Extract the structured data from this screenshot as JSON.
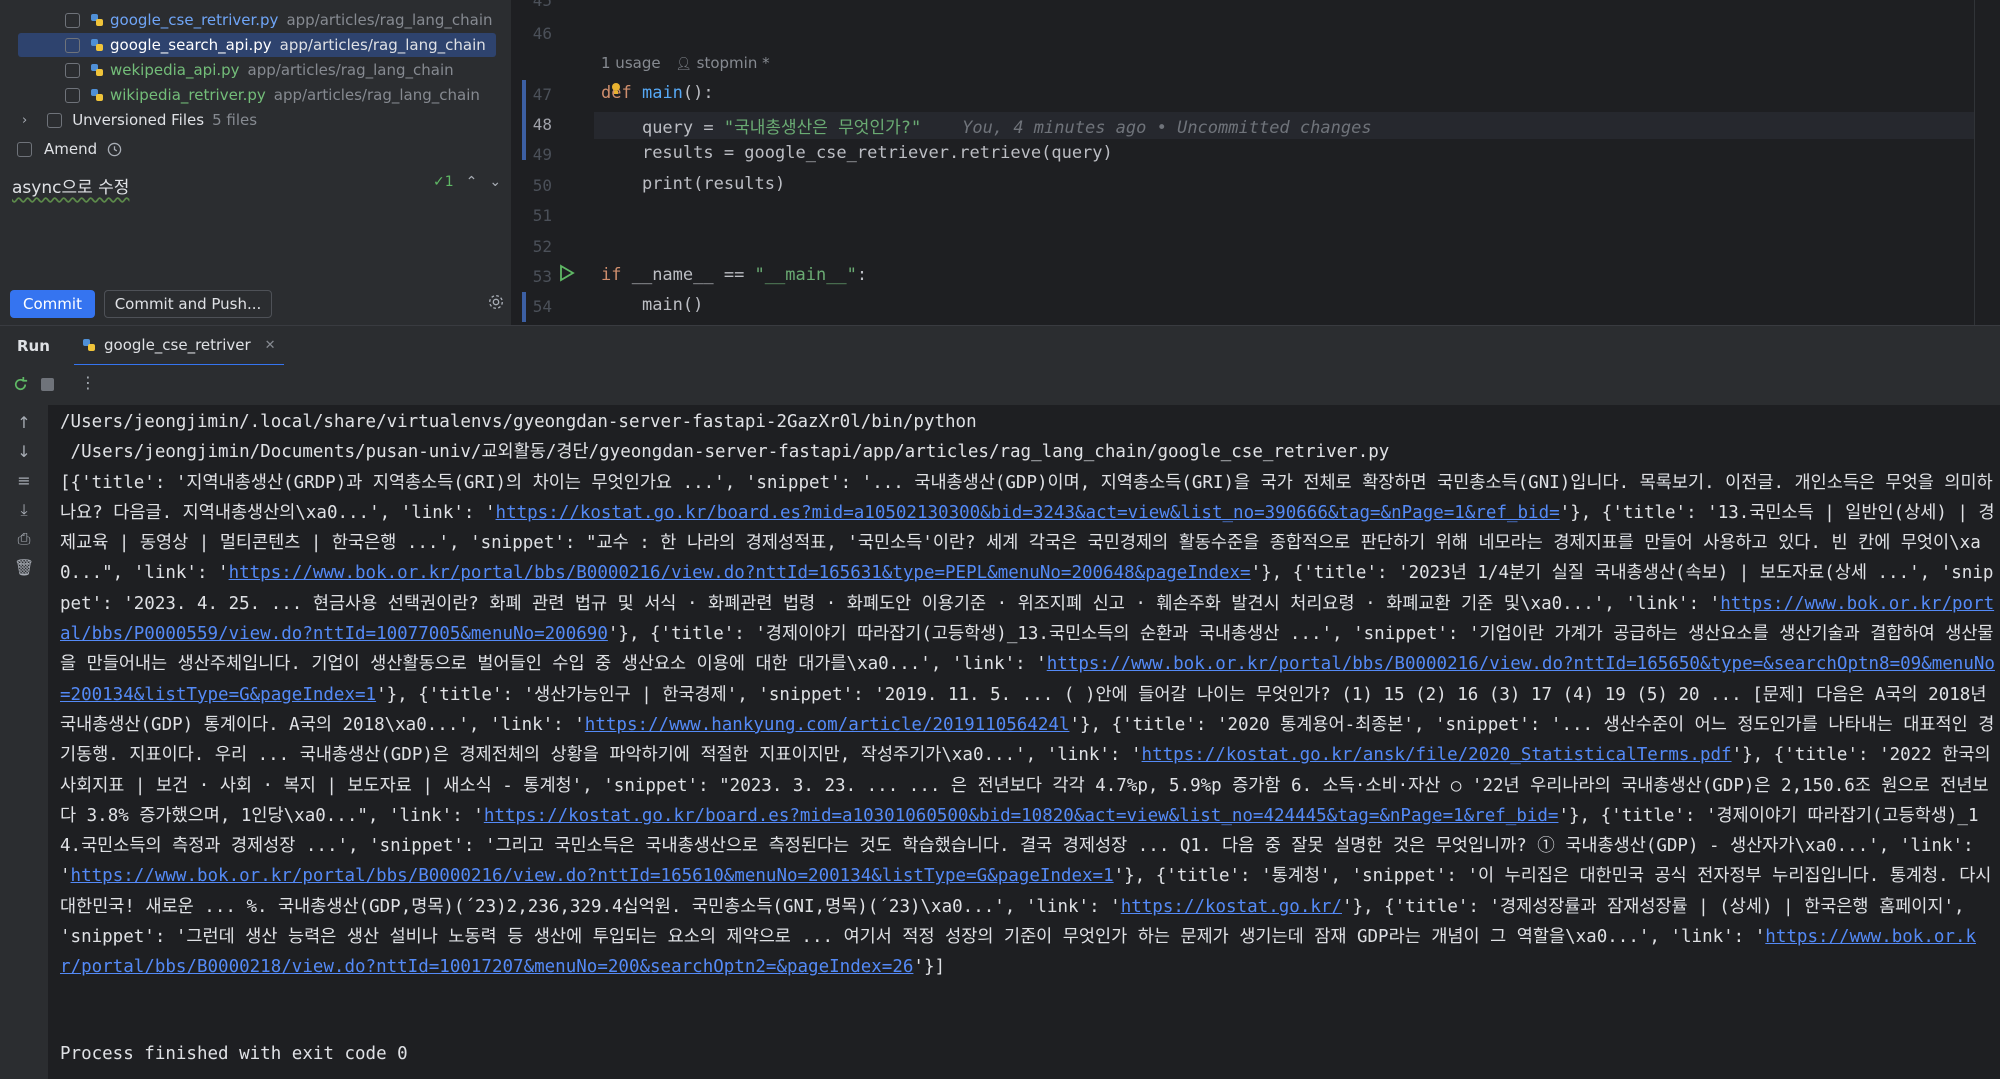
{
  "commit_panel": {
    "files": [
      {
        "name": "google_cse_retriver.py",
        "path": "app/articles/rag_lang_chain",
        "status": "modified"
      },
      {
        "name": "google_search_api.py",
        "path": "app/articles/rag_lang_chain",
        "status": "modified",
        "selected": true
      },
      {
        "name": "wekipedia_api.py",
        "path": "app/articles/rag_lang_chain",
        "status": "added"
      },
      {
        "name": "wikipedia_retriver.py",
        "path": "app/articles/rag_lang_chain",
        "status": "added"
      }
    ],
    "unversioned_label": "Unversioned Files",
    "unversioned_count": "5 files",
    "amend_label": "Amend",
    "commit_message": "async으로 수정",
    "message_check_count": "1",
    "commit_button": "Commit",
    "commit_push_button": "Commit and Push..."
  },
  "editor": {
    "line_numbers": [
      "45",
      "46",
      "47",
      "48",
      "49",
      "50",
      "51",
      "52",
      "53",
      "54"
    ],
    "usage_hint": "1 usage",
    "author_hint": "stopmin *",
    "line47": {
      "kw": "def",
      "name": "main",
      "rest": "():"
    },
    "line48": {
      "var": "query",
      "op": " = ",
      "str": "\"국내총생산은 무엇인가?\"",
      "blame": "You, 4 minutes ago • Uncommitted changes"
    },
    "line49": "results = google_cse_retriever.retrieve(query)",
    "line50": "print(results)",
    "line53": {
      "kw": "if",
      "rest": " __name__ == ",
      "str": "\"__main__\"",
      "colon": ":"
    },
    "line54": "main()"
  },
  "run_window": {
    "title": "Run",
    "tab_label": "google_cse_retriver",
    "console_lines": {
      "python_path": "/Users/jeongjimin/.local/share/virtualenvs/gyeongdan-server-fastapi-2GazXr0l/bin/python",
      "script_path": " /Users/jeongjimin/Documents/pusan-univ/교외활동/경단/gyeongdan-server-fastapi/app/articles/rag_lang_chain/google_cse_retriver.py",
      "seg1": "[{'title': '지역내총생산(GRDP)과 지역총소득(GRI)의 차이는 무엇인가요 ...', 'snippet': '... 국내총생산(GDP)이며, 지역총소득(GRI)을 국가 전체로 확장하면 국민총소득(GNI)입니다. 목록보기. 이전글. 개인소득은 무엇을 의미하나요? 다음글. 지역내총생산의\\xa0...', 'link': '",
      "link1": "https://kostat.go.kr/board.es?mid=a10502130300&bid=3243&act=view&list_no=390666&tag=&nPage=1&ref_bid=",
      "seg2": "'}, {'title': '13.국민소득 | 일반인(상세) | 경제교육 | 동영상 | 멀티콘텐츠 | 한국은행 ...', 'snippet': \"교수 : 한 나라의 경제성적표, '국민소득'이란? 세계 각국은 국민경제의 활동수준을 종합적으로 판단하기 위해 네모라는 경제지표를 만들어 사용하고 있다. 빈 칸에 무엇이\\xa0...\", 'link': '",
      "link2": "https://www.bok.or.kr/portal/bbs/B0000216/view.do?nttId=165631&type=PEPL&menuNo=200648&pageIndex=",
      "seg3": "'}, {'title': '2023년 1/4분기 실질 국내총생산(속보) | 보도자료(상세 ...', 'snippet': '2023. 4. 25. ... 현금사용 선택권이란? 화폐 관련 법규 및 서식 · 화폐관련 법령 · 화폐도안 이용기준 · 위조지폐 신고 · 훼손주화 발견시 처리요령 · 화폐교환 기준 및\\xa0...', 'link': '",
      "link3": "https://www.bok.or.kr/portal/bbs/P0000559/view.do?nttId=10077005&menuNo=200690",
      "seg4": "'}, {'title': '경제이야기 따라잡기(고등학생)_13.국민소득의 순환과 국내총생산 ...', 'snippet': '기업이란 가계가 공급하는 생산요소를 생산기술과 결합하여 생산물을 만들어내는 생산주체입니다. 기업이 생산활동으로 벌어들인 수입 중 생산요소 이용에 대한 대가를\\xa0...', 'link': '",
      "link4": "https://www.bok.or.kr/portal/bbs/B0000216/view.do?nttId=165650&type=&searchOptn8=09&menuNo=200134&listType=G&pageIndex=1",
      "seg5": "'}, {'title': '생산가능인구 | 한국경제', 'snippet': '2019. 11. 5. ... ( )안에 들어갈 나이는 무엇인가? (1) 15 (2) 16 (3) 17 (4) 19 (5) 20 ... [문제] 다음은 A국의 2018년 국내총생산(GDP) 통계이다. A국의 2018\\xa0...', 'link': '",
      "link5": "https://www.hankyung.com/article/201911056424l",
      "seg6": "'}, {'title': '2020 통계용어-최종본', 'snippet': '... 생산수준이 어느 정도인가를 나타내는 대표적인 경기동행. 지표이다. 우리 ... 국내총생산(GDP)은 경제전체의 상황을 파악하기에 적절한 지표이지만, 작성주기가\\xa0...', 'link': '",
      "link6": "https://kostat.go.kr/ansk/file/2020_StatisticalTerms.pdf",
      "seg7": "'}, {'title': '2022 한국의 사회지표 | 보건 · 사회 · 복지 | 보도자료 | 새소식 - 통계청', 'snippet': \"2023. 3. 23. ... ... 은 전년보다 각각 4.7%p, 5.9%p 증가함 6. 소득·소비·자산 ○ '22년 우리나라의 국내총생산(GDP)은 2,150.6조 원으로 전년보다 3.8% 증가했으며, 1인당\\xa0...\", 'link': '",
      "link7": "https://kostat.go.kr/board.es?mid=a10301060500&bid=10820&act=view&list_no=424445&tag=&nPage=1&ref_bid=",
      "seg8": "'}, {'title': '경제이야기 따라잡기(고등학생)_14.국민소득의 측정과 경제성장 ...', 'snippet': '그리고 국민소득은 국내총생산으로 측정된다는 것도 학습했습니다. 결국 경제성장 ... Q1. 다음 중 잘못 설명한 것은 무엇입니까? ① 국내총생산(GDP) - 생산자가\\xa0...', 'link': '",
      "link8": "https://www.bok.or.kr/portal/bbs/B0000216/view.do?nttId=165610&menuNo=200134&listType=G&pageIndex=1",
      "seg9": "'}, {'title': '통계청', 'snippet': '이 누리집은 대한민국 공식 전자정부 누리집입니다. 통계청. 다시 대한민국! 새로운 ... %. 국내총생산(GDP,명목)(´23)2,236,329.4십억원. 국민총소득(GNI,명목)(´23)\\xa0...', 'link': '",
      "link9": "https://kostat.go.kr/",
      "seg10": "'}, {'title': '경제성장률과 잠재성장률 | (상세) | 한국은행 홈페이지', 'snippet': '그런데 생산 능력은 생산 설비나 노동력 등 생산에 투입되는 요소의 제약으로 ... 여기서 적정 성장의 기준이 무엇인가 하는 문제가 생기는데 잠재 GDP라는 개념이 그 역할을\\xa0...', 'link': '",
      "link10": "https://www.bok.or.kr/portal/bbs/B0000218/view.do?nttId=10017207&menuNo=200&searchOptn2=&pageIndex=26",
      "seg11": "'}]"
    },
    "exit_message": "Process finished with exit code 0"
  },
  "colors": {
    "accent": "#3574f0",
    "panel_bg": "#2b2d30",
    "editor_bg": "#1e1f22",
    "link": "#548af7",
    "modified_file": "#6fa5f7",
    "added_file": "#73bd79"
  }
}
